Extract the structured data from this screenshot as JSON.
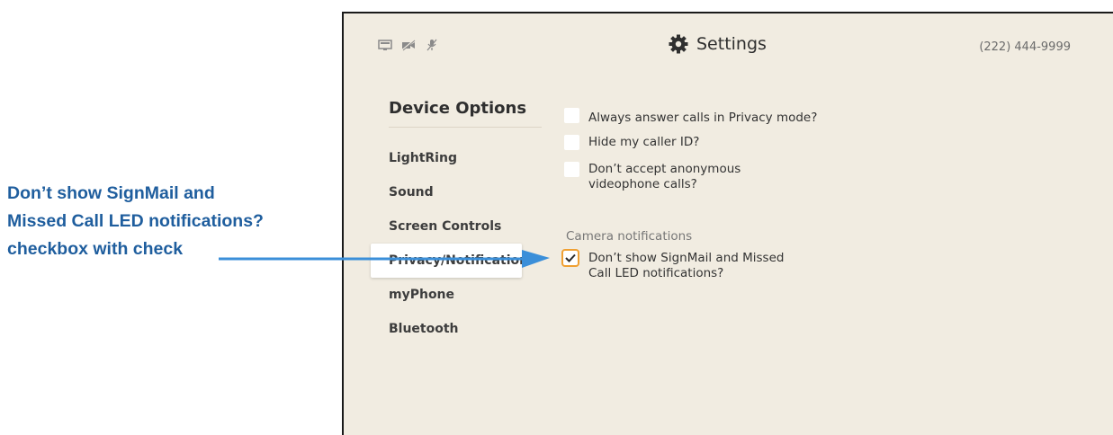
{
  "callout": {
    "line1": "Don’t show SignMail and",
    "line2": "Missed Call LED notifications?",
    "line3": "checkbox with check"
  },
  "header": {
    "title": "Settings",
    "phone": "(222) 444-9999",
    "status_icons": [
      "display-icon",
      "video-off-icon",
      "mic-off-icon"
    ]
  },
  "sidebar": {
    "heading": "Device Options",
    "items": [
      {
        "label": "LightRing"
      },
      {
        "label": "Sound"
      },
      {
        "label": "Screen Controls"
      },
      {
        "label": "Privacy/Notifications",
        "selected": true
      },
      {
        "label": "myPhone"
      },
      {
        "label": "Bluetooth"
      }
    ]
  },
  "options": [
    {
      "label": "Always answer calls in Privacy mode?",
      "checked": false
    },
    {
      "label": "Hide my caller ID?",
      "checked": false
    },
    {
      "label_line1": "Don’t accept anonymous",
      "label_line2": "videophone calls?",
      "checked": false
    }
  ],
  "camera": {
    "section_label": "Camera notifications",
    "option": {
      "label_line1": "Don’t show SignMail and Missed",
      "label_line2": "Call LED notifications?",
      "checked": true
    }
  },
  "colors": {
    "accent": "#f0a032",
    "callout": "#1f5e9e",
    "arrow": "#3b8fd9",
    "background": "#f1ece1"
  }
}
